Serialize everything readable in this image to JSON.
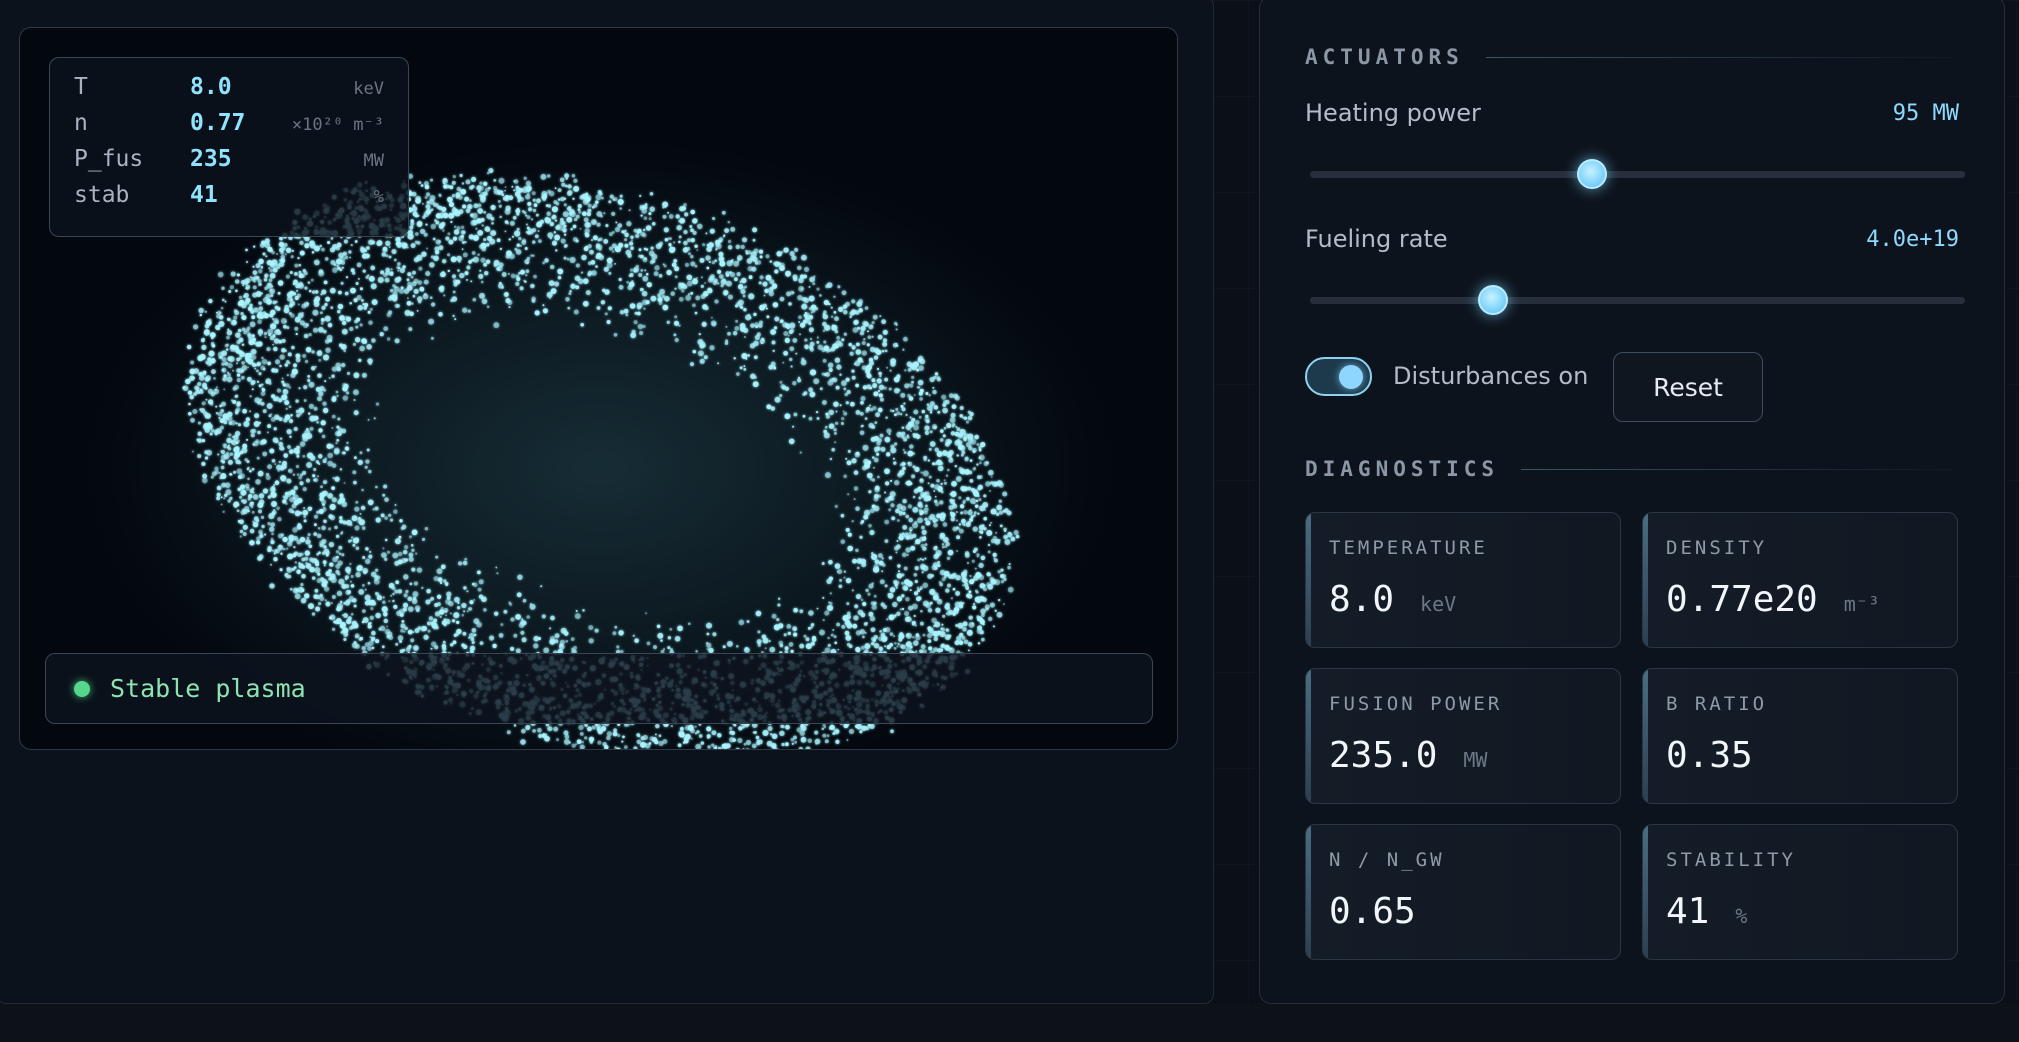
{
  "viewport": {
    "readout": [
      {
        "key": "T",
        "value": "8.0",
        "unit": "keV"
      },
      {
        "key": "n",
        "value": "0.77",
        "unit": "×10²⁰ m⁻³"
      },
      {
        "key": "P_fus",
        "value": "235",
        "unit": "MW"
      },
      {
        "key": "stab",
        "value": "41",
        "unit": "%"
      }
    ],
    "status": {
      "text": "Stable plasma",
      "color": "#58d68d"
    },
    "particle_color": "#a8f4ff"
  },
  "actuators": {
    "title": "ACTUATORS",
    "heating": {
      "label": "Heating power",
      "value": "95 MW",
      "fraction": 0.43
    },
    "fueling": {
      "label": "Fueling rate",
      "value": "4.0e+19",
      "fraction": 0.28
    },
    "disturbances": {
      "label": "Disturbances on",
      "enabled": true
    },
    "reset_label": "Reset"
  },
  "diagnostics": {
    "title": "DIAGNOSTICS",
    "cards": [
      {
        "label": "TEMPERATURE",
        "value": "8.0",
        "unit": "keV"
      },
      {
        "label": "DENSITY",
        "value": "0.77e20",
        "unit": "m⁻³"
      },
      {
        "label": "FUSION POWER",
        "value": "235.0",
        "unit": "MW"
      },
      {
        "label": "B RATIO",
        "value": "0.35",
        "unit": ""
      },
      {
        "label": "N / N_GW",
        "value": "0.65",
        "unit": ""
      },
      {
        "label": "STABILITY",
        "value": "41",
        "unit": "%"
      }
    ]
  },
  "colors": {
    "accent": "#8fd9ff",
    "panel_bg": "#0d131c",
    "viz_bg": "#03070e"
  }
}
